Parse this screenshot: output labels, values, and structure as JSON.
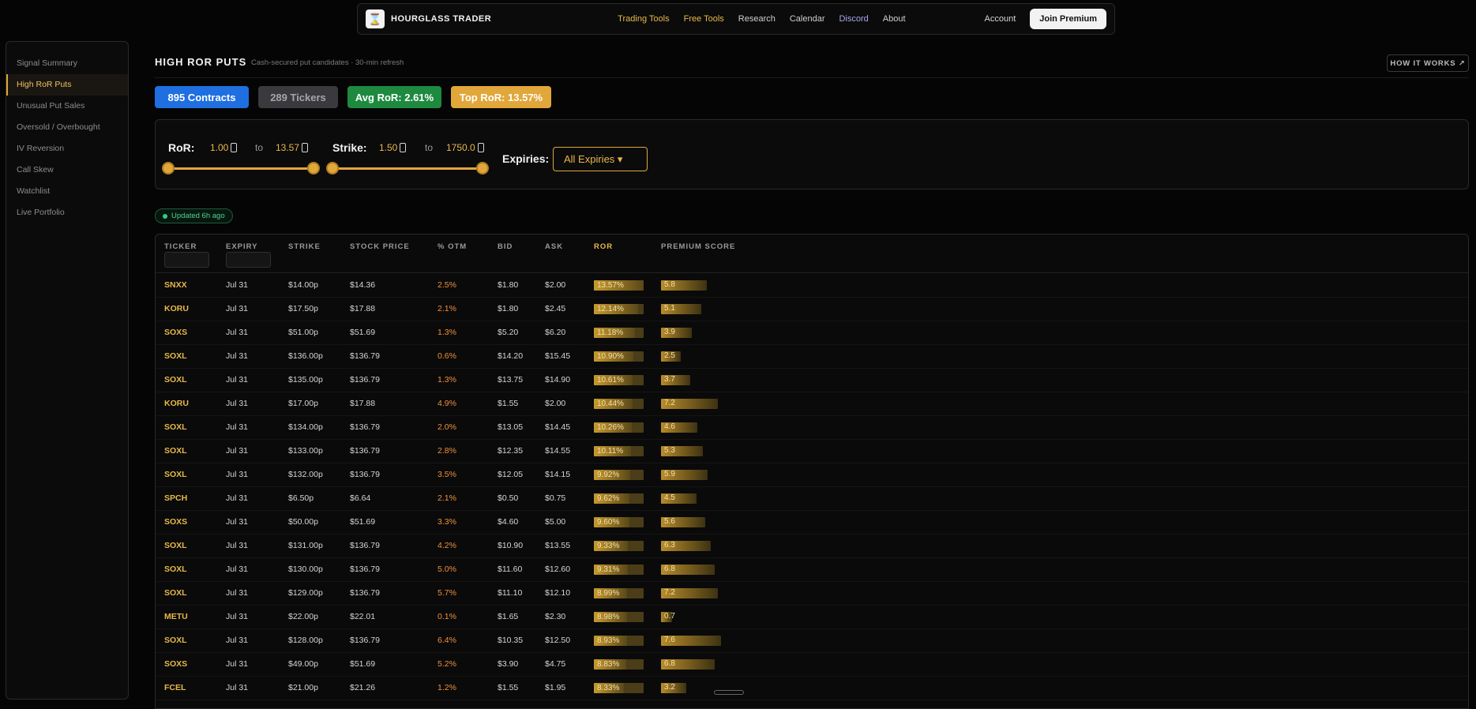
{
  "nav": {
    "brand": "HOURGLASS TRADER",
    "links": [
      "Trading Tools",
      "Free Tools",
      "Research",
      "Calendar",
      "Discord",
      "About"
    ],
    "account": "Account",
    "join": "Join Premium"
  },
  "sidebar": {
    "items": [
      "Signal Summary",
      "High RoR Puts",
      "Unusual Put Sales",
      "Oversold / Overbought",
      "IV Reversion",
      "Call Skew",
      "Watchlist",
      "Live Portfolio"
    ],
    "active_index": 1
  },
  "header": {
    "title": "HIGH ROR PUTS",
    "subtitle": "Cash-secured put candidates · 30-min refresh",
    "how_it_works": "HOW IT WORKS ↗"
  },
  "stats": {
    "contracts": "895 Contracts",
    "tickers": "289 Tickers",
    "avg_ror": "Avg RoR: 2.61%",
    "top_ror": "Top RoR: 13.57%"
  },
  "filters": {
    "ror_label": "RoR:",
    "ror_min": "1.00",
    "ror_max": "13.57",
    "to": "to",
    "strike_label": "Strike:",
    "strike_min": "1.50",
    "strike_max": "1750.0",
    "expiries_label": "Expiries:",
    "expiries_value": "All Expiries ▾"
  },
  "updated": "Updated 6h ago",
  "table": {
    "headers": [
      "TICKER",
      "EXPIRY",
      "STRIKE",
      "STOCK PRICE",
      "% OTM",
      "BID",
      "ASK",
      "ROR",
      "PREMIUM SCORE"
    ],
    "rows": [
      {
        "ticker": "SNXX",
        "expiry": "Jul 31",
        "strike": "$14.00p",
        "price": "$14.36",
        "otm": "2.5%",
        "bid": "$1.80",
        "ask": "$2.00",
        "ror": "13.57%",
        "ror_pct": 1.0,
        "score": "5.8"
      },
      {
        "ticker": "KORU",
        "expiry": "Jul 31",
        "strike": "$17.50p",
        "price": "$17.88",
        "otm": "2.1%",
        "bid": "$1.80",
        "ask": "$2.45",
        "ror": "12.14%",
        "ror_pct": 0.89,
        "score": "5.1"
      },
      {
        "ticker": "SOXS",
        "expiry": "Jul 31",
        "strike": "$51.00p",
        "price": "$51.69",
        "otm": "1.3%",
        "bid": "$5.20",
        "ask": "$6.20",
        "ror": "11.18%",
        "ror_pct": 0.82,
        "score": "3.9"
      },
      {
        "ticker": "SOXL",
        "expiry": "Jul 31",
        "strike": "$136.00p",
        "price": "$136.79",
        "otm": "0.6%",
        "bid": "$14.20",
        "ask": "$15.45",
        "ror": "10.90%",
        "ror_pct": 0.8,
        "score": "2.5"
      },
      {
        "ticker": "SOXL",
        "expiry": "Jul 31",
        "strike": "$135.00p",
        "price": "$136.79",
        "otm": "1.3%",
        "bid": "$13.75",
        "ask": "$14.90",
        "ror": "10.61%",
        "ror_pct": 0.78,
        "score": "3.7"
      },
      {
        "ticker": "KORU",
        "expiry": "Jul 31",
        "strike": "$17.00p",
        "price": "$17.88",
        "otm": "4.9%",
        "bid": "$1.55",
        "ask": "$2.00",
        "ror": "10.44%",
        "ror_pct": 0.77,
        "score": "7.2"
      },
      {
        "ticker": "SOXL",
        "expiry": "Jul 31",
        "strike": "$134.00p",
        "price": "$136.79",
        "otm": "2.0%",
        "bid": "$13.05",
        "ask": "$14.45",
        "ror": "10.26%",
        "ror_pct": 0.76,
        "score": "4.6"
      },
      {
        "ticker": "SOXL",
        "expiry": "Jul 31",
        "strike": "$133.00p",
        "price": "$136.79",
        "otm": "2.8%",
        "bid": "$12.35",
        "ask": "$14.55",
        "ror": "10.11%",
        "ror_pct": 0.75,
        "score": "5.3"
      },
      {
        "ticker": "SOXL",
        "expiry": "Jul 31",
        "strike": "$132.00p",
        "price": "$136.79",
        "otm": "3.5%",
        "bid": "$12.05",
        "ask": "$14.15",
        "ror": "9.92%",
        "ror_pct": 0.73,
        "score": "5.9"
      },
      {
        "ticker": "SPCH",
        "expiry": "Jul 31",
        "strike": "$6.50p",
        "price": "$6.64",
        "otm": "2.1%",
        "bid": "$0.50",
        "ask": "$0.75",
        "ror": "9.62%",
        "ror_pct": 0.71,
        "score": "4.5"
      },
      {
        "ticker": "SOXS",
        "expiry": "Jul 31",
        "strike": "$50.00p",
        "price": "$51.69",
        "otm": "3.3%",
        "bid": "$4.60",
        "ask": "$5.00",
        "ror": "9.60%",
        "ror_pct": 0.71,
        "score": "5.6"
      },
      {
        "ticker": "SOXL",
        "expiry": "Jul 31",
        "strike": "$131.00p",
        "price": "$136.79",
        "otm": "4.2%",
        "bid": "$10.90",
        "ask": "$13.55",
        "ror": "9.33%",
        "ror_pct": 0.69,
        "score": "6.3"
      },
      {
        "ticker": "SOXL",
        "expiry": "Jul 31",
        "strike": "$130.00p",
        "price": "$136.79",
        "otm": "5.0%",
        "bid": "$11.60",
        "ask": "$12.60",
        "ror": "9.31%",
        "ror_pct": 0.69,
        "score": "6.8"
      },
      {
        "ticker": "SOXL",
        "expiry": "Jul 31",
        "strike": "$129.00p",
        "price": "$136.79",
        "otm": "5.7%",
        "bid": "$11.10",
        "ask": "$12.10",
        "ror": "8.99%",
        "ror_pct": 0.66,
        "score": "7.2"
      },
      {
        "ticker": "METU",
        "expiry": "Jul 31",
        "strike": "$22.00p",
        "price": "$22.01",
        "otm": "0.1%",
        "bid": "$1.65",
        "ask": "$2.30",
        "ror": "8.98%",
        "ror_pct": 0.66,
        "score": "0.7"
      },
      {
        "ticker": "SOXL",
        "expiry": "Jul 31",
        "strike": "$128.00p",
        "price": "$136.79",
        "otm": "6.4%",
        "bid": "$10.35",
        "ask": "$12.50",
        "ror": "8.93%",
        "ror_pct": 0.66,
        "score": "7.6"
      },
      {
        "ticker": "SOXS",
        "expiry": "Jul 31",
        "strike": "$49.00p",
        "price": "$51.69",
        "otm": "5.2%",
        "bid": "$3.90",
        "ask": "$4.75",
        "ror": "8.83%",
        "ror_pct": 0.65,
        "score": "6.8"
      },
      {
        "ticker": "FCEL",
        "expiry": "Jul 31",
        "strike": "$21.00p",
        "price": "$21.26",
        "otm": "1.2%",
        "bid": "$1.55",
        "ask": "$1.95",
        "ror": "8.33%",
        "ror_pct": 0.61,
        "score": "3.2"
      }
    ]
  }
}
